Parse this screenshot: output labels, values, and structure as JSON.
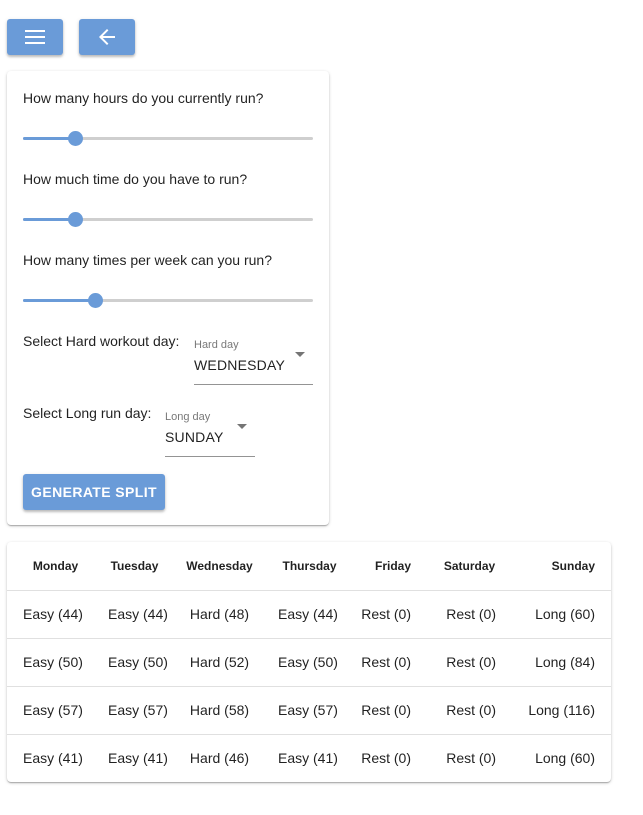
{
  "toolbar": {
    "menu_icon": "menu-icon",
    "back_icon": "arrow-back-icon"
  },
  "colors": {
    "accent": "#6a9bd8",
    "rail": "#cfcfcf"
  },
  "form": {
    "q_hours": "How many hours do you currently run?",
    "hours_value": 0.18,
    "q_time": "How much time do you have to run?",
    "time_value": 0.18,
    "q_times": "How many times per week can you run?",
    "times_value": 0.25,
    "hard_label": "Select Hard workout day:",
    "hard_select_label": "Hard day",
    "hard_select_value": "WEDNESDAY",
    "long_label": "Select Long run day:",
    "long_select_label": "Long day",
    "long_select_value": "SUNDAY",
    "generate_label": "GENERATE SPLIT"
  },
  "table": {
    "headers": [
      "Monday",
      "Tuesday",
      "Wednesday",
      "Thursday",
      "Friday",
      "Saturday",
      "Sunday"
    ],
    "rows": [
      [
        "Easy (44)",
        "Easy (44)",
        "Hard (48)",
        "Easy (44)",
        "Rest (0)",
        "Rest (0)",
        "Long (60)"
      ],
      [
        "Easy (50)",
        "Easy (50)",
        "Hard (52)",
        "Easy (50)",
        "Rest (0)",
        "Rest (0)",
        "Long (84)"
      ],
      [
        "Easy (57)",
        "Easy (57)",
        "Hard (58)",
        "Easy (57)",
        "Rest (0)",
        "Rest (0)",
        "Long (116)"
      ],
      [
        "Easy (41)",
        "Easy (41)",
        "Hard (46)",
        "Easy (41)",
        "Rest (0)",
        "Rest (0)",
        "Long (60)"
      ]
    ]
  }
}
